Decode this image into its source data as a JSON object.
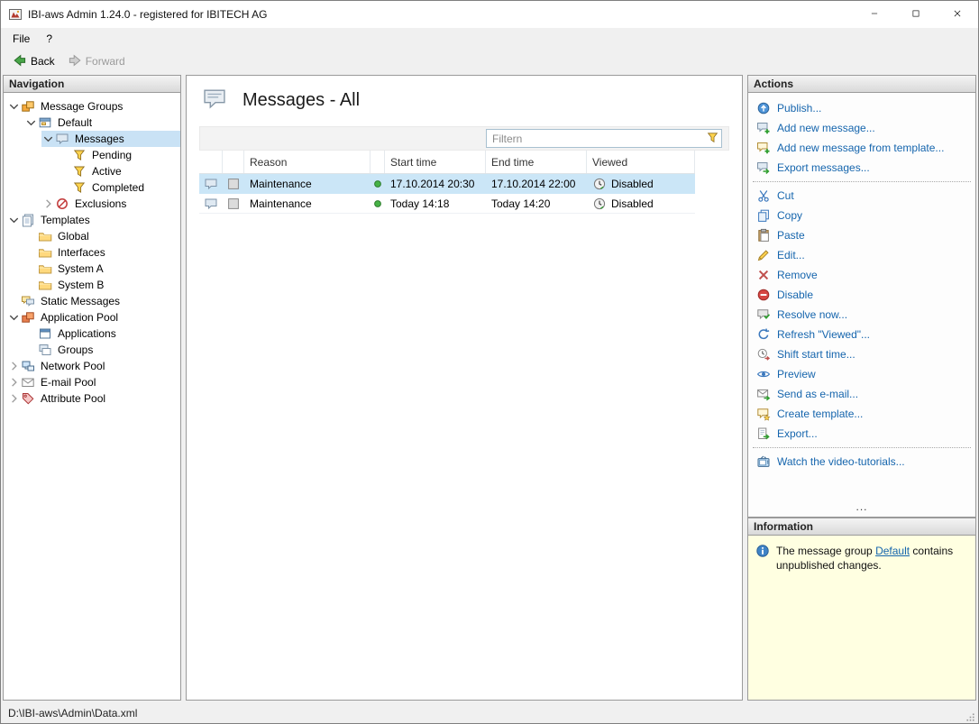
{
  "window": {
    "title": "IBI-aws Admin 1.24.0 - registered for IBITECH AG"
  },
  "menu": {
    "items": [
      {
        "label": "File"
      },
      {
        "label": "?"
      }
    ]
  },
  "toolbar": {
    "back_label": "Back",
    "forward_label": "Forward"
  },
  "navigation": {
    "header": "Navigation",
    "items": [
      {
        "label": "Message Groups",
        "level": 0,
        "chevron": "expanded",
        "icon": "message-groups-icon",
        "selected": false
      },
      {
        "label": "Default",
        "level": 1,
        "chevron": "expanded",
        "icon": "group-icon",
        "selected": false
      },
      {
        "label": "Messages",
        "level": 2,
        "chevron": "expanded",
        "icon": "message-bubble-icon",
        "selected": true
      },
      {
        "label": "Pending",
        "level": 3,
        "chevron": "none",
        "icon": "funnel-icon",
        "selected": false
      },
      {
        "label": "Active",
        "level": 3,
        "chevron": "none",
        "icon": "funnel-icon",
        "selected": false
      },
      {
        "label": "Completed",
        "level": 3,
        "chevron": "none",
        "icon": "funnel-icon",
        "selected": false
      },
      {
        "label": "Exclusions",
        "level": 2,
        "chevron": "collapsed",
        "icon": "exclusions-icon",
        "selected": false
      },
      {
        "label": "Templates",
        "level": 0,
        "chevron": "expanded",
        "icon": "templates-icon",
        "selected": false
      },
      {
        "label": "Global",
        "level": 1,
        "chevron": "none",
        "icon": "folder-icon",
        "selected": false
      },
      {
        "label": "Interfaces",
        "level": 1,
        "chevron": "none",
        "icon": "folder-icon",
        "selected": false
      },
      {
        "label": "System A",
        "level": 1,
        "chevron": "none",
        "icon": "folder-icon",
        "selected": false
      },
      {
        "label": "System B",
        "level": 1,
        "chevron": "none",
        "icon": "folder-icon",
        "selected": false
      },
      {
        "label": "Static Messages",
        "level": 0,
        "chevron": "none",
        "icon": "static-messages-icon",
        "selected": false
      },
      {
        "label": "Application Pool",
        "level": 0,
        "chevron": "expanded",
        "icon": "application-pool-icon",
        "selected": false
      },
      {
        "label": "Applications",
        "level": 1,
        "chevron": "none",
        "icon": "applications-icon",
        "selected": false
      },
      {
        "label": "Groups",
        "level": 1,
        "chevron": "none",
        "icon": "groups-icon",
        "selected": false
      },
      {
        "label": "Network Pool",
        "level": 0,
        "chevron": "collapsed",
        "icon": "network-pool-icon",
        "selected": false
      },
      {
        "label": "E-mail Pool",
        "level": 0,
        "chevron": "collapsed",
        "icon": "email-pool-icon",
        "selected": false
      },
      {
        "label": "Attribute Pool",
        "level": 0,
        "chevron": "collapsed",
        "icon": "attribute-pool-icon",
        "selected": false
      }
    ]
  },
  "content": {
    "title": "Messages - All",
    "filter_placeholder": "Filtern",
    "table": {
      "columns": [
        {
          "label": ""
        },
        {
          "label": ""
        },
        {
          "label": "Reason"
        },
        {
          "label": ""
        },
        {
          "label": "Start time"
        },
        {
          "label": "End time"
        },
        {
          "label": "Viewed"
        }
      ],
      "rows": [
        {
          "reason": "Maintenance",
          "start": "17.10.2014 20:30",
          "end": "17.10.2014 22:00",
          "viewed": "Disabled",
          "selected": true
        },
        {
          "reason": "Maintenance",
          "start": "Today 14:18",
          "end": "Today 14:20",
          "viewed": "Disabled",
          "selected": false
        }
      ]
    }
  },
  "actions": {
    "header": "Actions",
    "overflow": "...",
    "groups": [
      {
        "items": [
          {
            "label": "Publish...",
            "icon": "publish-icon"
          },
          {
            "label": "Add new message...",
            "icon": "add-message-icon"
          },
          {
            "label": "Add new message from template...",
            "icon": "add-message-template-icon"
          },
          {
            "label": "Export messages...",
            "icon": "export-messages-icon"
          }
        ]
      },
      {
        "items": [
          {
            "label": "Cut",
            "icon": "cut-icon"
          },
          {
            "label": "Copy",
            "icon": "copy-icon"
          },
          {
            "label": "Paste",
            "icon": "paste-icon"
          },
          {
            "label": "Edit...",
            "icon": "edit-icon"
          },
          {
            "label": "Remove",
            "icon": "remove-icon"
          },
          {
            "label": "Disable",
            "icon": "disable-icon"
          },
          {
            "label": "Resolve now...",
            "icon": "resolve-icon"
          },
          {
            "label": "Refresh \"Viewed\"...",
            "icon": "refresh-icon"
          },
          {
            "label": "Shift start time...",
            "icon": "shift-time-icon"
          },
          {
            "label": "Preview",
            "icon": "preview-icon"
          },
          {
            "label": "Send as e-mail...",
            "icon": "send-email-icon"
          },
          {
            "label": "Create template...",
            "icon": "create-template-icon"
          },
          {
            "label": "Export...",
            "icon": "export-icon"
          }
        ]
      },
      {
        "items": [
          {
            "label": "Watch the video-tutorials...",
            "icon": "video-icon"
          }
        ]
      }
    ]
  },
  "information": {
    "header": "Information",
    "text_before": "The message group ",
    "link": "Default",
    "text_after": " contains unpublished changes."
  },
  "statusbar": {
    "path": "D:\\IBI-aws\\Admin\\Data.xml"
  }
}
